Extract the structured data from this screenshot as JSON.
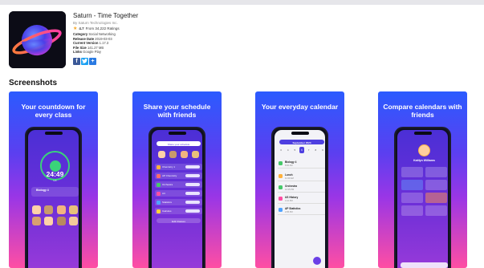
{
  "app": {
    "title": "Saturn - Time Together",
    "developer": "By Saturn Technologies Inc.",
    "rating_value": "4.7",
    "rating_text": "From 34,222 Ratings",
    "meta": [
      {
        "label": "Category",
        "value": "Social Networking"
      },
      {
        "label": "Release Date",
        "value": "2019-03-03"
      },
      {
        "label": "Current Version",
        "value": "1.17.3"
      },
      {
        "label": "File Size",
        "value": "141.27 MB"
      },
      {
        "label": "Links",
        "value": "Google Play"
      }
    ],
    "share_icons": [
      "facebook-icon",
      "twitter-icon",
      "plus-share-icon"
    ]
  },
  "screenshots": {
    "title": "Screenshots",
    "items": [
      {
        "caption": "Your countdown for every class"
      },
      {
        "caption": "Share your schedule with friends"
      },
      {
        "caption": "Your everyday calendar"
      },
      {
        "caption": "Compare calendars with friends"
      }
    ]
  },
  "colors": {
    "gradient_top": "#2b5bff",
    "gradient_mid": "#9a36e6",
    "gradient_bottom": "#ff4ea3",
    "accent": "#4e3fe0",
    "rating_star": "#f5a623"
  }
}
